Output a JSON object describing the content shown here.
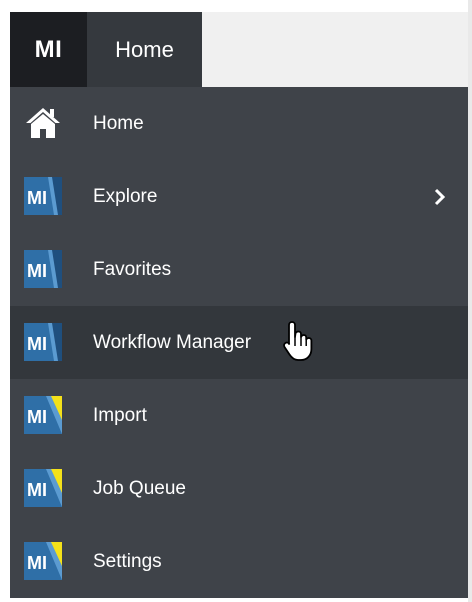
{
  "header": {
    "logo_text": "MI",
    "tab_label": "Home"
  },
  "menu": {
    "items": [
      {
        "label": "Home",
        "icon": "house-icon"
      },
      {
        "label": "Explore",
        "icon": "mi-app-icon",
        "submenu_icon": "chevron-right-icon"
      },
      {
        "label": "Favorites",
        "icon": "mi-app-icon"
      },
      {
        "label": "Workflow Manager",
        "icon": "mi-app-icon"
      },
      {
        "label": "Import",
        "icon": "mi-app-yellow-icon"
      },
      {
        "label": "Job Queue",
        "icon": "mi-app-yellow-icon"
      },
      {
        "label": "Settings",
        "icon": "mi-app-yellow-icon"
      }
    ],
    "mi_icon_text": "MI"
  },
  "colors": {
    "menu_bg": "#3f4349",
    "hover_bg": "#33373c",
    "logo_bg": "#1c1e22",
    "tab_bg": "#35393e",
    "icon_blue": "#2f6fa7",
    "icon_yellow": "#f4e11a"
  },
  "cursor": {
    "icon": "hand-pointer-icon"
  }
}
